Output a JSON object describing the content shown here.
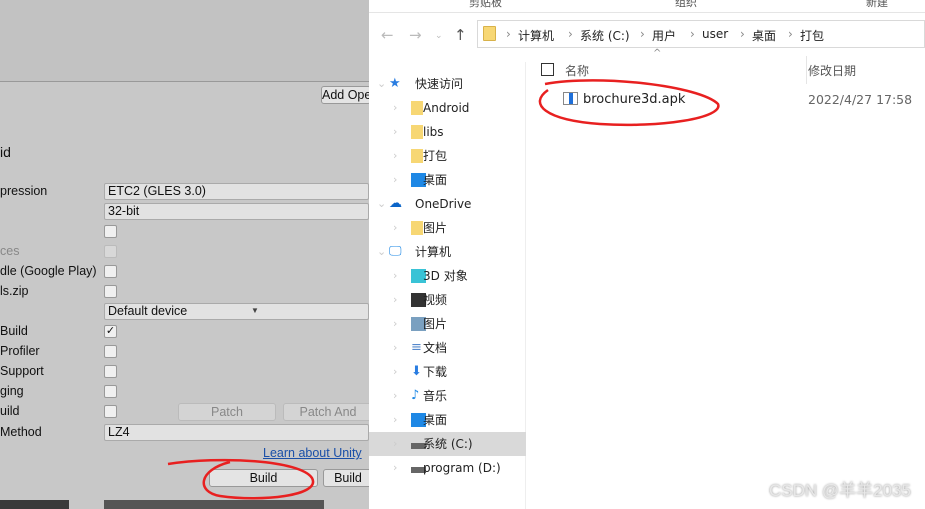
{
  "unity": {
    "add_button": "Add Ope",
    "section_title": "id",
    "rows": [
      {
        "label": "pression",
        "type": "dropdown",
        "value": "ETC2 (GLES 3.0)"
      },
      {
        "label": "",
        "type": "dropdown",
        "value": "32-bit"
      },
      {
        "label": "",
        "type": "checkbox",
        "checked": false
      },
      {
        "label": "ces",
        "type": "checkbox",
        "checked": false,
        "disabled": true
      },
      {
        "label": "dle (Google Play)",
        "type": "checkbox",
        "checked": false
      },
      {
        "label": "ls.zip",
        "type": "checkbox",
        "checked": false
      },
      {
        "label": "",
        "type": "dropdown",
        "value": "Default device"
      },
      {
        "label": "Build",
        "type": "checkbox",
        "checked": true
      },
      {
        "label": "Profiler",
        "type": "checkbox",
        "checked": false
      },
      {
        "label": "Support",
        "type": "checkbox",
        "checked": false
      },
      {
        "label": "ging",
        "type": "checkbox",
        "checked": false
      },
      {
        "label": "uild",
        "type": "checkbox",
        "checked": false
      },
      {
        "label": "Method",
        "type": "dropdown",
        "value": "LZ4"
      }
    ],
    "patch_label": "Patch",
    "patch_and_run_label": "Patch And",
    "learn_link": "Learn about Unity",
    "build_label": "Build",
    "build_and_run_label": "Build"
  },
  "explorer": {
    "ribbon": [
      "剪贴板",
      "组织",
      "新建"
    ],
    "breadcrumb": [
      "计算机",
      "系统 (C:)",
      "用户",
      "user",
      "桌面",
      "打包"
    ],
    "columns": {
      "name": "名称",
      "date": "修改日期"
    },
    "files": [
      {
        "name": "brochure3d.apk",
        "date": "2022/4/27 17:58",
        "icon": "apk-file-icon"
      }
    ],
    "nav": [
      {
        "label": "快速访问",
        "icon": "star-icon",
        "level": 0
      },
      {
        "label": "Android",
        "icon": "folder-icon",
        "level": 1
      },
      {
        "label": "libs",
        "icon": "folder-icon",
        "level": 1
      },
      {
        "label": "打包",
        "icon": "folder-icon",
        "level": 1
      },
      {
        "label": "桌面",
        "icon": "desktop-icon",
        "level": 1
      },
      {
        "label": "OneDrive",
        "icon": "cloud-icon",
        "level": 0
      },
      {
        "label": "图片",
        "icon": "folder-icon",
        "level": 1
      },
      {
        "label": "计算机",
        "icon": "computer-icon",
        "level": 0
      },
      {
        "label": "3D 对象",
        "icon": "cube-icon",
        "level": 1
      },
      {
        "label": "视频",
        "icon": "video-icon",
        "level": 1
      },
      {
        "label": "图片",
        "icon": "picture-icon",
        "level": 1
      },
      {
        "label": "文档",
        "icon": "document-icon",
        "level": 1
      },
      {
        "label": "下载",
        "icon": "download-icon",
        "level": 1
      },
      {
        "label": "音乐",
        "icon": "music-icon",
        "level": 1
      },
      {
        "label": "桌面",
        "icon": "desktop-icon",
        "level": 1
      },
      {
        "label": "系统 (C:)",
        "icon": "drive-icon",
        "level": 1,
        "selected": true
      },
      {
        "label": "program (D:)",
        "icon": "drive-icon",
        "level": 1
      }
    ]
  },
  "watermark": "CSDN @羊羊2035",
  "colors": {
    "annotation": "#e82020",
    "link": "#1a4fa8"
  }
}
